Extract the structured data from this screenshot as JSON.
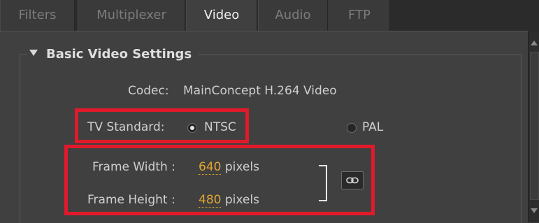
{
  "tabs": [
    "Filters",
    "Multiplexer",
    "Video",
    "Audio",
    "FTP"
  ],
  "section": {
    "title": "Basic Video Settings"
  },
  "codec": {
    "label": "Codec:",
    "value": "MainConcept H.264 Video"
  },
  "tv_standard": {
    "label": "TV Standard:",
    "options": [
      {
        "label": "NTSC",
        "selected": true
      },
      {
        "label": "PAL",
        "selected": false
      }
    ]
  },
  "frame_width": {
    "label": "Frame Width :",
    "value": "640",
    "unit": "pixels"
  },
  "frame_height": {
    "label": "Frame Height :",
    "value": "480",
    "unit": "pixels"
  },
  "icons": {
    "section_toggle": "triangle-down-icon",
    "link": "chain-link-icon"
  },
  "colors": {
    "highlight": "#e01a2a",
    "value": "#e0a531",
    "panel": "#404040"
  }
}
